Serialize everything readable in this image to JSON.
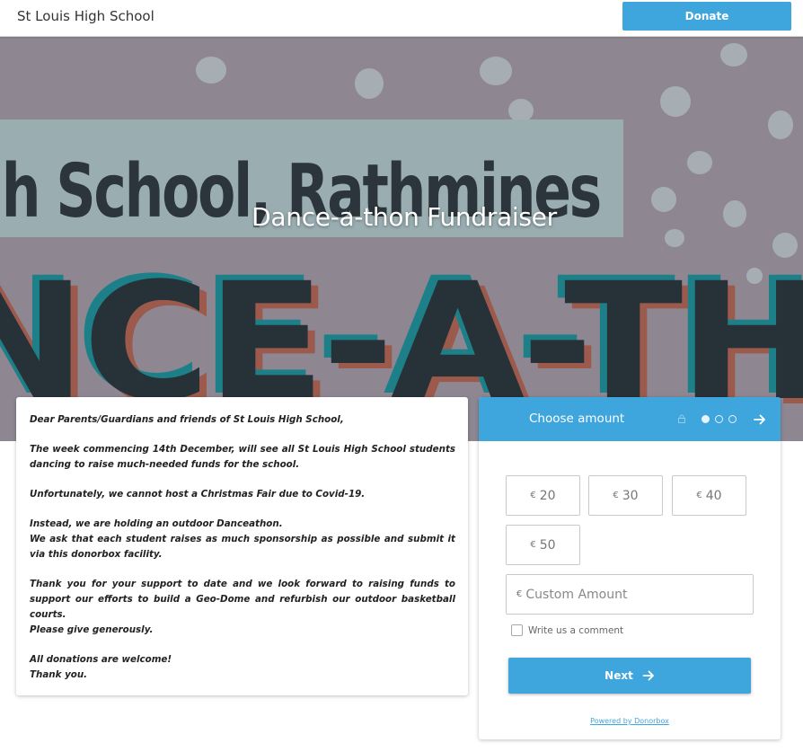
{
  "header": {
    "org_name": "St Louis High School",
    "donate_label": "Donate"
  },
  "banner": {
    "title": "Dance-a-thon Fundraiser",
    "image_text_line1": "gh School, Rathmines",
    "image_text_line2": "NCE-A-TH"
  },
  "letter": {
    "paragraphs": [
      "Dear Parents/Guardians and friends of St Louis High School,",
      "The week commencing 14th December, will see all St Louis High School students dancing to raise much-needed funds for the school.",
      "Unfortunately, we cannot host a Christmas Fair due to Covid-19.",
      "Instead, we are holding an outdoor Danceathon.\nWe ask that each student raises as much sponsorship as possible and submit it via this donorbox facility.",
      "Thank you for your support to date and we look forward to raising funds to support our efforts to build a Geo-Dome and refurbish our outdoor basketball courts.\nPlease give generously.",
      "All donations are welcome!\nThank you."
    ]
  },
  "form": {
    "title": "Choose amount",
    "currency": "€",
    "amounts": [
      "20",
      "30",
      "40",
      "50"
    ],
    "custom_placeholder": "Custom Amount",
    "comment_label": "Write us a comment",
    "next_label": "Next",
    "powered_by": "Powered by Donorbox",
    "step_current": 1,
    "step_total": 3
  },
  "colors": {
    "accent": "#3fa5dd",
    "banner_bg": "#8e8792"
  }
}
